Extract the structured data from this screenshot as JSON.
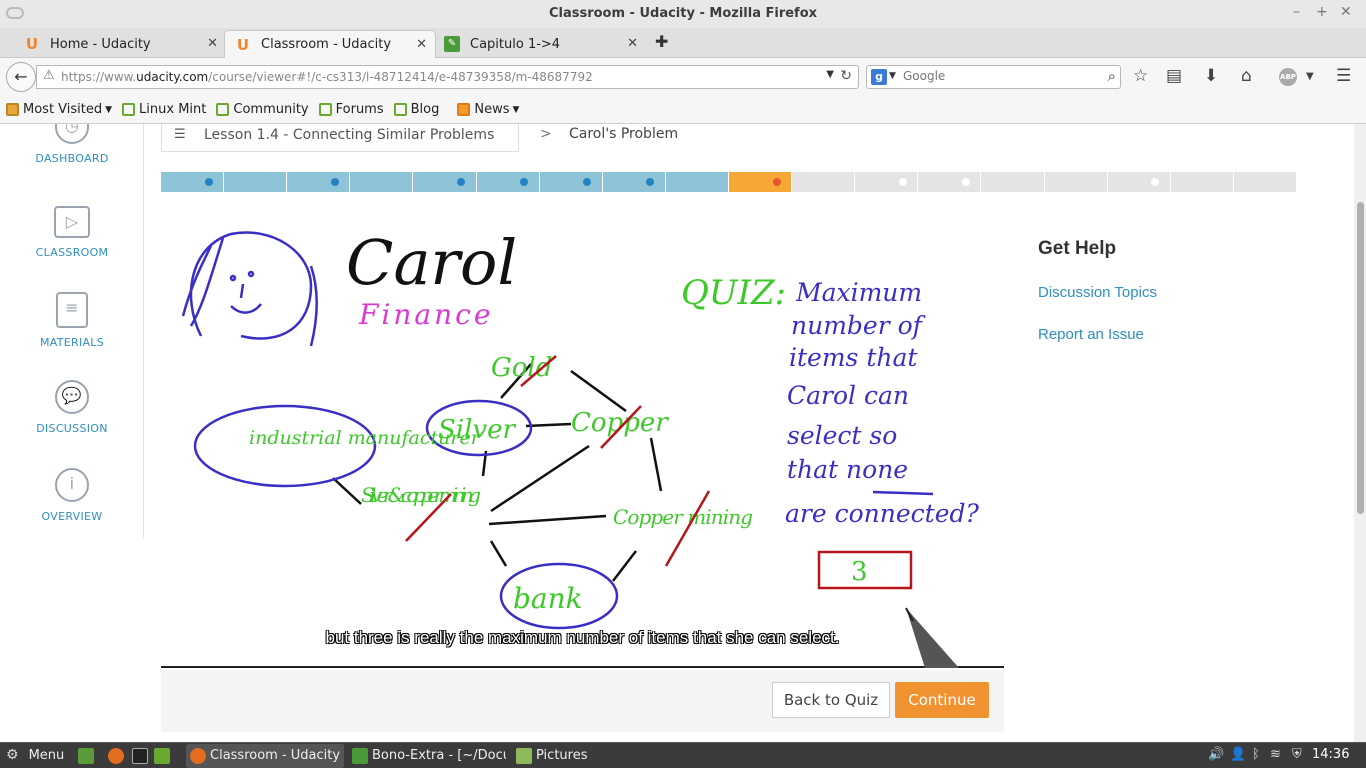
{
  "window": {
    "title": "Classroom - Udacity - Mozilla Firefox",
    "minimize": "–",
    "maximize": "+",
    "close": "✕"
  },
  "tabs": [
    {
      "label": "Home - Udacity",
      "icon": "udacity-icon",
      "close": "✕"
    },
    {
      "label": "Classroom - Udacity",
      "icon": "udacity-icon",
      "close": "✕"
    },
    {
      "label": "Capitulo 1->4",
      "icon": "document-icon",
      "close": "✕"
    }
  ],
  "new_tab": "✚",
  "navbar": {
    "url_prefix": "https://www.",
    "url_domain": "udacity.com",
    "url_path": "/course/viewer#!/c-cs313/l-48712414/e-48739358/m-48687792",
    "search_placeholder": "Google",
    "search_engine": "g"
  },
  "bookmarks": [
    {
      "label": "Most Visited",
      "dropdown": true,
      "kind": "folder"
    },
    {
      "label": "Linux Mint",
      "kind": "mint"
    },
    {
      "label": "Community",
      "kind": "mint"
    },
    {
      "label": "Forums",
      "kind": "mint"
    },
    {
      "label": "Blog",
      "kind": "mint"
    },
    {
      "label": "News",
      "dropdown": true,
      "kind": "rss"
    }
  ],
  "leftnav": [
    {
      "label": "DASHBOARD",
      "icon": "dashboard-icon"
    },
    {
      "label": "CLASSROOM",
      "icon": "play-icon"
    },
    {
      "label": "MATERIALS",
      "icon": "notebook-icon"
    },
    {
      "label": "DISCUSSION",
      "icon": "chat-bubbles-icon"
    },
    {
      "label": "OVERVIEW",
      "icon": "info-icon"
    }
  ],
  "breadcrumb": {
    "lesson": "Lesson 1.4 - Connecting Similar Problems",
    "separator": ">",
    "current": "Carol's Problem"
  },
  "progress": {
    "segments": [
      {
        "state": "done",
        "dot": true
      },
      {
        "state": "done",
        "dot": false
      },
      {
        "state": "done",
        "dot": true
      },
      {
        "state": "done",
        "dot": false
      },
      {
        "state": "done",
        "dot": true
      },
      {
        "state": "done",
        "dot": true
      },
      {
        "state": "done",
        "dot": true
      },
      {
        "state": "done",
        "dot": true
      },
      {
        "state": "done",
        "dot": false
      },
      {
        "state": "current",
        "dot": true
      },
      {
        "state": "todo",
        "dot": false
      },
      {
        "state": "todo",
        "dot": true
      },
      {
        "state": "todo",
        "dot": true
      },
      {
        "state": "todo",
        "dot": false
      },
      {
        "state": "todo",
        "dot": false
      },
      {
        "state": "todo",
        "dot": true
      },
      {
        "state": "todo",
        "dot": false
      },
      {
        "state": "todo",
        "dot": false
      }
    ],
    "colors": {
      "done": "#8fc3d8",
      "current": "#f5a836",
      "todo": "#e4e4e4",
      "done_dot": "#2583c4",
      "current_dot": "#e5572b",
      "todo_dot": "#ffffff"
    }
  },
  "video": {
    "name_text": "Carol",
    "role_text": "Finance",
    "quiz_label": "QUIZ:",
    "quiz_lines": [
      "Maximum",
      "number of",
      "items that",
      "Carol can",
      "select so",
      "that none",
      "are connected?"
    ],
    "answer": "3",
    "nodes": [
      "Gold",
      "Silver",
      "Copper",
      "industrial manufacturer",
      "Silver & copper mining",
      "Copper mining",
      "bank"
    ],
    "caption": "but three is really the maximum number of items that she can select."
  },
  "buttons": {
    "back_to_quiz": "Back to Quiz",
    "continue": "Continue"
  },
  "help": {
    "title": "Get Help",
    "links": [
      "Discussion Topics",
      "Report an Issue"
    ]
  },
  "taskbar": {
    "menu_label": "Menu",
    "windows": [
      {
        "label": "Classroom - Udacity -...",
        "active": true
      },
      {
        "label": "Bono-Extra - [~/Docu...",
        "active": false
      },
      {
        "label": "Pictures",
        "active": false
      }
    ],
    "clock": "14:36"
  }
}
